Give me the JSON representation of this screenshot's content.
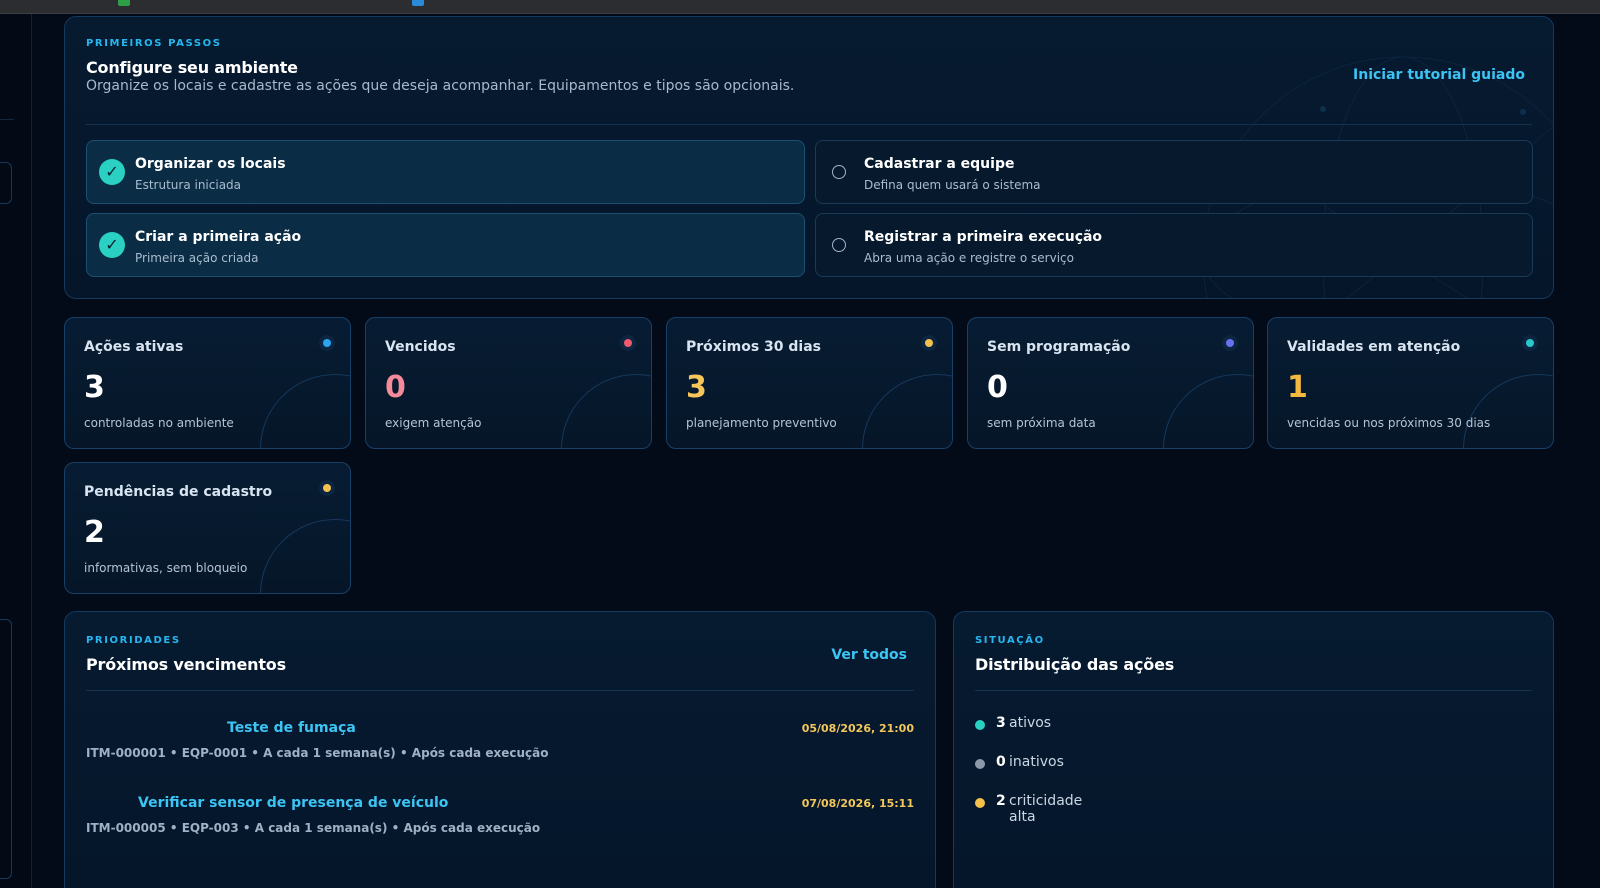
{
  "onboarding": {
    "eyebrow": "PRIMEIROS PASSOS",
    "title": "Configure seu ambiente",
    "subtitle": "Organize os locais e cadastre as ações que deseja acompanhar. Equipamentos e tipos são opcionais.",
    "tutorial_link": "Iniciar tutorial guiado",
    "steps": [
      {
        "title": "Organizar os locais",
        "subtitle": "Estrutura iniciada",
        "done": true
      },
      {
        "title": "Cadastrar a equipe",
        "subtitle": "Defina quem usará o sistema",
        "done": false
      },
      {
        "title": "Criar a primeira ação",
        "subtitle": "Primeira ação criada",
        "done": true
      },
      {
        "title": "Registrar a primeira execução",
        "subtitle": "Abra uma ação e registre o serviço",
        "done": false
      }
    ]
  },
  "metrics": [
    {
      "title": "Ações ativas",
      "value": "3",
      "subtitle": "controladas no ambiente",
      "dot_color": "#2aa6ee",
      "value_color": "#ffffff"
    },
    {
      "title": "Vencidos",
      "value": "0",
      "subtitle": "exigem atenção",
      "dot_color": "#ef5a6f",
      "value_color": "#f58a9a"
    },
    {
      "title": "Próximos 30 dias",
      "value": "3",
      "subtitle": "planejamento preventivo",
      "dot_color": "#f4c14d",
      "value_color": "#f6c65b"
    },
    {
      "title": "Sem programação",
      "value": "0",
      "subtitle": "sem próxima data",
      "dot_color": "#6a6ff0",
      "value_color": "#ffffff"
    },
    {
      "title": "Validades em atenção",
      "value": "1",
      "subtitle": "vencidas ou nos próximos 30 dias",
      "dot_color": "#27c9c9",
      "value_color": "#f4b93e"
    },
    {
      "title": "Pendências de cadastro",
      "value": "2",
      "subtitle": "informativas, sem bloqueio",
      "dot_color": "#f4c14d",
      "value_color": "#ffffff"
    }
  ],
  "priorities": {
    "eyebrow": "PRIORIDADES",
    "title": "Próximos vencimentos",
    "view_all": "Ver todos",
    "items": [
      {
        "title": "Teste de fumaça",
        "meta": "ITM-000001 • EQP-0001 • A cada 1 semana(s) • Após cada execução",
        "date": "05/08/2026, 21:00"
      },
      {
        "title": "Verificar sensor de presença de veículo",
        "meta": "ITM-000005 • EQP-003 • A cada 1 semana(s) • Após cada execução",
        "date": "07/08/2026, 15:11"
      }
    ]
  },
  "situation": {
    "eyebrow": "SITUAÇÃO",
    "title": "Distribuição das ações",
    "stats": [
      {
        "count": "3",
        "label": "ativos",
        "color": "#2ad1c2"
      },
      {
        "count": "0",
        "label": "inativos",
        "color": "#8c99a8"
      },
      {
        "count": "2",
        "label": "criticidade alta",
        "color": "#f4c14d"
      }
    ]
  },
  "icons": {
    "check": "✓"
  }
}
